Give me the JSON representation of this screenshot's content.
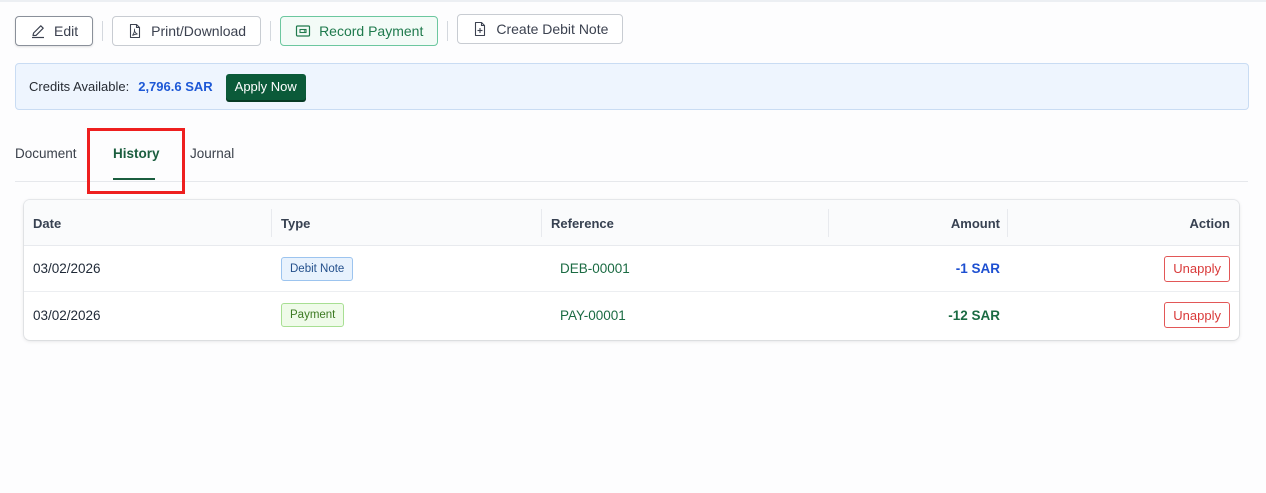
{
  "toolbar": {
    "edit_label": "Edit",
    "print_label": "Print/Download",
    "record_payment_label": "Record Payment",
    "debit_note_label": "Create Debit Note"
  },
  "credits": {
    "label": "Credits Available:",
    "amount": "2,796.6 SAR",
    "apply_label": "Apply Now"
  },
  "tabs": [
    {
      "label": "Document",
      "active": false
    },
    {
      "label": "History",
      "active": true
    },
    {
      "label": "Journal",
      "active": false
    }
  ],
  "table": {
    "columns": [
      "Date",
      "Type",
      "Reference",
      "Amount",
      "Action"
    ],
    "rows": [
      {
        "date": "03/02/2026",
        "type": "Debit Note",
        "reference": "DEB-00001",
        "amount": "-1 SAR",
        "action": "Unapply"
      },
      {
        "date": "03/02/2026",
        "type": "Payment",
        "reference": "PAY-00001",
        "amount": "-12 SAR",
        "action": "Unapply"
      }
    ]
  },
  "colors": {
    "accent_green": "#1b5e3f",
    "credit_blue": "#1d58d6",
    "highlight_red": "#ee1f1f"
  }
}
